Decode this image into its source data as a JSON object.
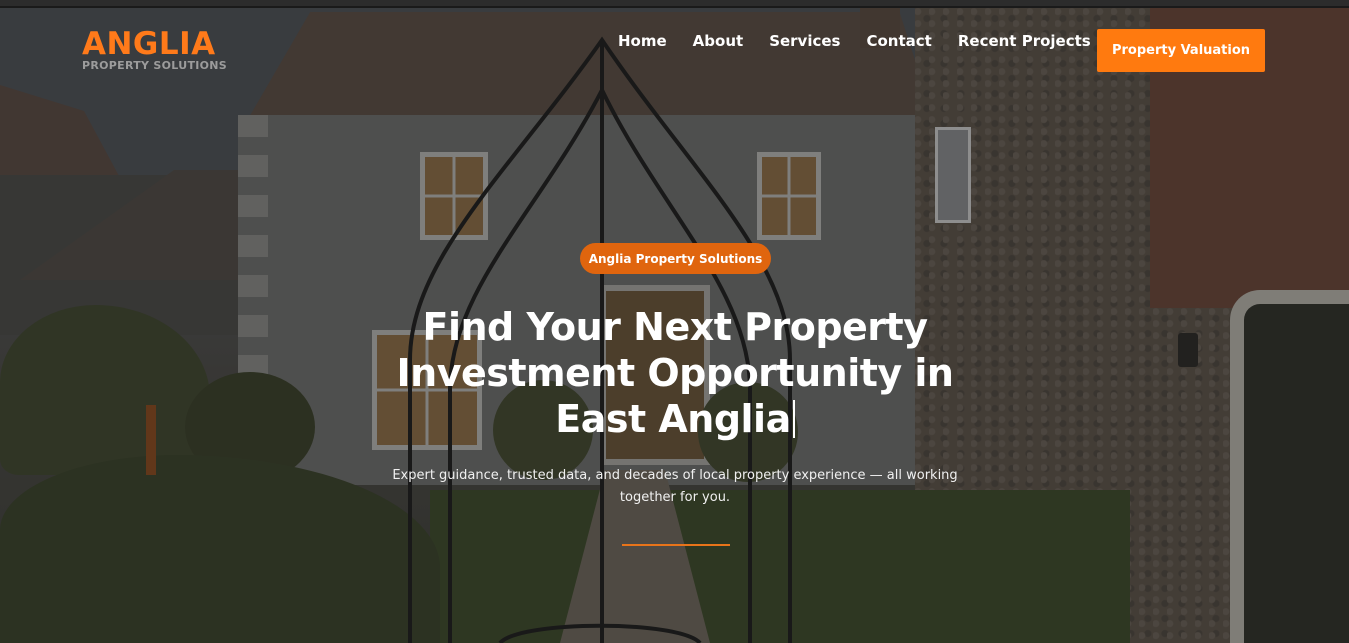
{
  "brand": {
    "name": "ANGLIA",
    "tagline": "PROPERTY SOLUTIONS"
  },
  "nav": {
    "items": [
      {
        "label": "Home"
      },
      {
        "label": "About"
      },
      {
        "label": "Services"
      },
      {
        "label": "Contact"
      },
      {
        "label": "Recent Projects"
      }
    ]
  },
  "cta": {
    "label": "Property Valuation"
  },
  "hero": {
    "badge": "Anglia Property Solutions",
    "headline_line1": "Find Your Next Property",
    "headline_line2": "Investment Opportunity in",
    "headline_line3": "East Anglia",
    "subtext": "Expert guidance, trusted data, and decades of local property experience — all working together for you."
  },
  "colors": {
    "accent": "#ff7a0f",
    "badge": "#e0650e",
    "text_light": "#ffffff"
  }
}
